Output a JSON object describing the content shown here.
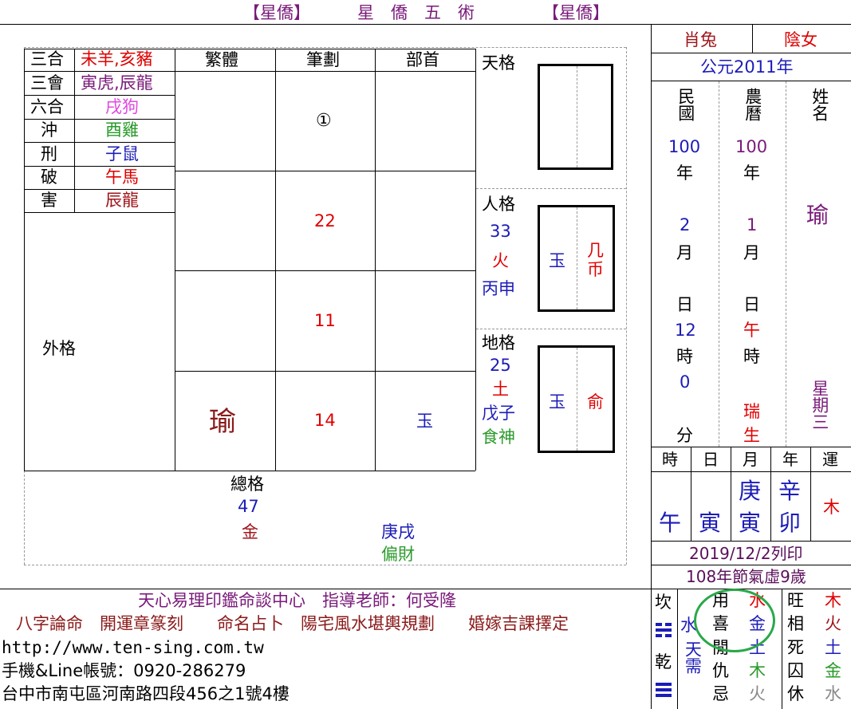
{
  "header": {
    "tag_left": "【星僑】",
    "title": "星　僑　五　術",
    "tag_right": "【星僑】"
  },
  "relations": [
    {
      "label": "三合",
      "value": "未羊,亥豬",
      "color": "#e00000"
    },
    {
      "label": "三會",
      "value": "寅虎,辰龍",
      "color": "#7a1a7a"
    },
    {
      "label": "六合",
      "value": "戌狗",
      "color": "#e04ae0"
    },
    {
      "label": "沖",
      "value": "酉雞",
      "color": "#2a9a2a"
    },
    {
      "label": "刑",
      "value": "子鼠",
      "color": "#1c1cb8"
    },
    {
      "label": "破",
      "value": "午馬",
      "color": "#e00000"
    },
    {
      "label": "害",
      "value": "辰龍",
      "color": "#a0151b"
    }
  ],
  "strokes_table": {
    "headers": [
      "繁體",
      "筆劃",
      "部首"
    ],
    "rows": [
      {
        "char": "",
        "strokes": "①",
        "radical": ""
      },
      {
        "char": "",
        "strokes": "22",
        "radical": ""
      },
      {
        "char": "",
        "strokes": "11",
        "radical": ""
      },
      {
        "char": "瑜",
        "strokes": "14",
        "radical": "玉"
      }
    ]
  },
  "waige": {
    "label": "外格"
  },
  "zongge": {
    "label": "總格",
    "number": "47",
    "element": "金",
    "ganzhi": "庚戌",
    "shishen": "偏財"
  },
  "tiange": {
    "label": "天格"
  },
  "renge": {
    "label": "人格",
    "number": "33",
    "element": "火",
    "ganzhi": "丙申",
    "box_left": "玉",
    "box_right": "几\n币"
  },
  "dige": {
    "label": "地格",
    "number": "25",
    "element": "土",
    "ganzhi": "戊子",
    "shishen": "食神",
    "box_left": "玉",
    "box_right": "俞"
  },
  "profile": {
    "zodiac": "肖兔",
    "gender": "陰女",
    "year": "公元2011年",
    "minguo_label": "民國",
    "nongli_label": "農曆",
    "name_label": "姓名",
    "minguo_year": "100",
    "nongli_year": "100",
    "nian": "年",
    "minguo_month": "2",
    "nongli_month": "1",
    "yue": "月",
    "ri": "日",
    "minguo_day": "12",
    "nongli_day": "午",
    "shi": "時",
    "minguo_hour": "0",
    "fen": "分",
    "rui": "瑞",
    "sheng": "生",
    "name_char": "瑜",
    "weekday": "星期三"
  },
  "pillars": {
    "headers": [
      "時",
      "日",
      "月",
      "年",
      "運"
    ],
    "hour": {
      "stem": "",
      "branch": "午"
    },
    "day": {
      "stem": "",
      "branch": "寅"
    },
    "month": {
      "stem": "庚",
      "branch": "寅"
    },
    "year": {
      "stem": "辛",
      "branch": "卯"
    },
    "yun": "木"
  },
  "print_date": "2019/12/2列印",
  "age_line": "108年節氣虛9歲",
  "footer": {
    "center": "天心易理印鑑命談中心　指導老師：何受隆",
    "services": "八字論命　開運章篆刻　　命名占卜　陽宅風水堪輿規劃　　婚嫁吉課擇定",
    "website": "http://www.ten-sing.com.tw",
    "phone": "手機&Line帳號：0920-286279",
    "address": "台中市南屯區河南路四段456之1號4樓"
  },
  "gua": {
    "top": "坎",
    "bottom": "乾",
    "water": "水",
    "tianxu": "天需"
  },
  "yongshen": [
    {
      "label": "用",
      "el": "水"
    },
    {
      "label": "喜",
      "el": "金"
    },
    {
      "label": "閒",
      "el": "土"
    },
    {
      "label": "仇",
      "el": "木"
    },
    {
      "label": "忌",
      "el": "火"
    }
  ],
  "wangxiang": [
    {
      "label": "旺",
      "el": "木"
    },
    {
      "label": "相",
      "el": "火"
    },
    {
      "label": "死",
      "el": "土"
    },
    {
      "label": "囚",
      "el": "金"
    },
    {
      "label": "休",
      "el": "水"
    }
  ]
}
